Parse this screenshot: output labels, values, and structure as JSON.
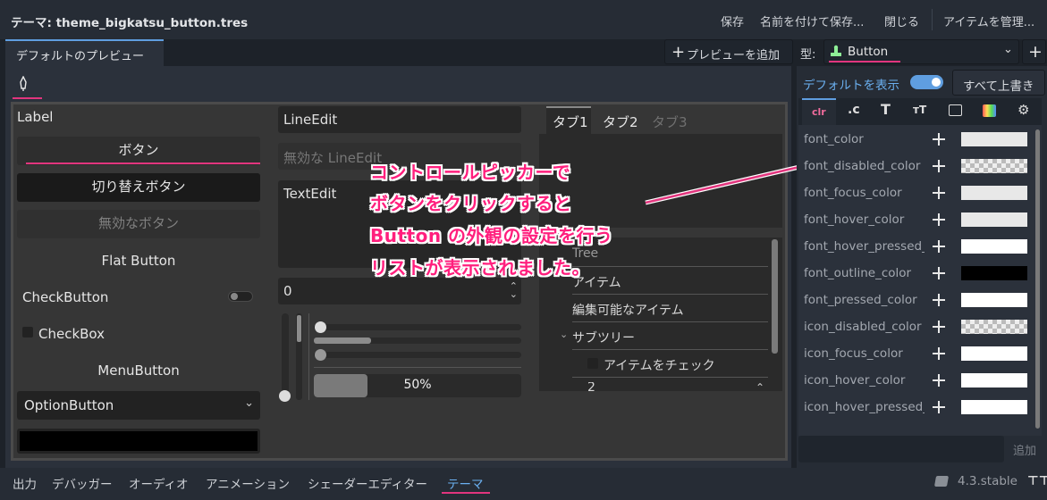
{
  "topbar": {
    "title": "テーマ: theme_bigkatsu_button.tres",
    "save": "保存",
    "save_as": "名前を付けて保存...",
    "close": "閉じる",
    "manage_items": "アイテムを管理..."
  },
  "tab": {
    "default_preview": "デフォルトのプレビュー",
    "add_preview": "プレビューを追加",
    "type_label": "型:",
    "type_value": "Button"
  },
  "preview": {
    "label": "Label",
    "button": "ボタン",
    "toggle_button": "切り替えボタン",
    "disabled_button": "無効なボタン",
    "flat_button": "Flat Button",
    "check_button": "CheckButton",
    "check_box": "CheckBox",
    "menu_button": "MenuButton",
    "option_button": "OptionButton",
    "line_edit": "LineEdit",
    "disabled_line_edit": "無効な LineEdit",
    "text_edit": "TextEdit",
    "spin_value": "0",
    "progress_text": "50%",
    "progress_value": 0.5,
    "tabs": [
      "タブ1",
      "タブ2",
      "タブ3"
    ],
    "tree": {
      "root": "Tree",
      "item": "アイテム",
      "editable_item": "編集可能なアイテム",
      "subtree": "サブツリー",
      "check_item": "アイテムをチェック",
      "range_value": "2"
    }
  },
  "annotation": {
    "line1": "コントロールピッカーで",
    "line2": "ボタンをクリックすると",
    "line3": "Button の外観の設定を行う",
    "line4": "リストが表示されました。"
  },
  "rightpanel": {
    "show_default": "デフォルトを表示",
    "override_all": "すべて上書き",
    "add_label": "追加",
    "properties": [
      "font_color",
      "font_disabled_color",
      "font_focus_color",
      "font_hover_color",
      "font_hover_pressed_",
      "font_outline_color",
      "font_pressed_color",
      "icon_disabled_color",
      "icon_focus_color",
      "icon_hover_color",
      "icon_hover_pressed_"
    ]
  },
  "bottombar": {
    "items": [
      "出力",
      "デバッガー",
      "オーディオ",
      "アニメーション",
      "シェーダーエディター",
      "テーマ"
    ],
    "version": "4.3.stable"
  },
  "colors": {
    "accent": "#5f9ee0",
    "annotation": "#ff1f7d",
    "underline": "#e2357e"
  }
}
